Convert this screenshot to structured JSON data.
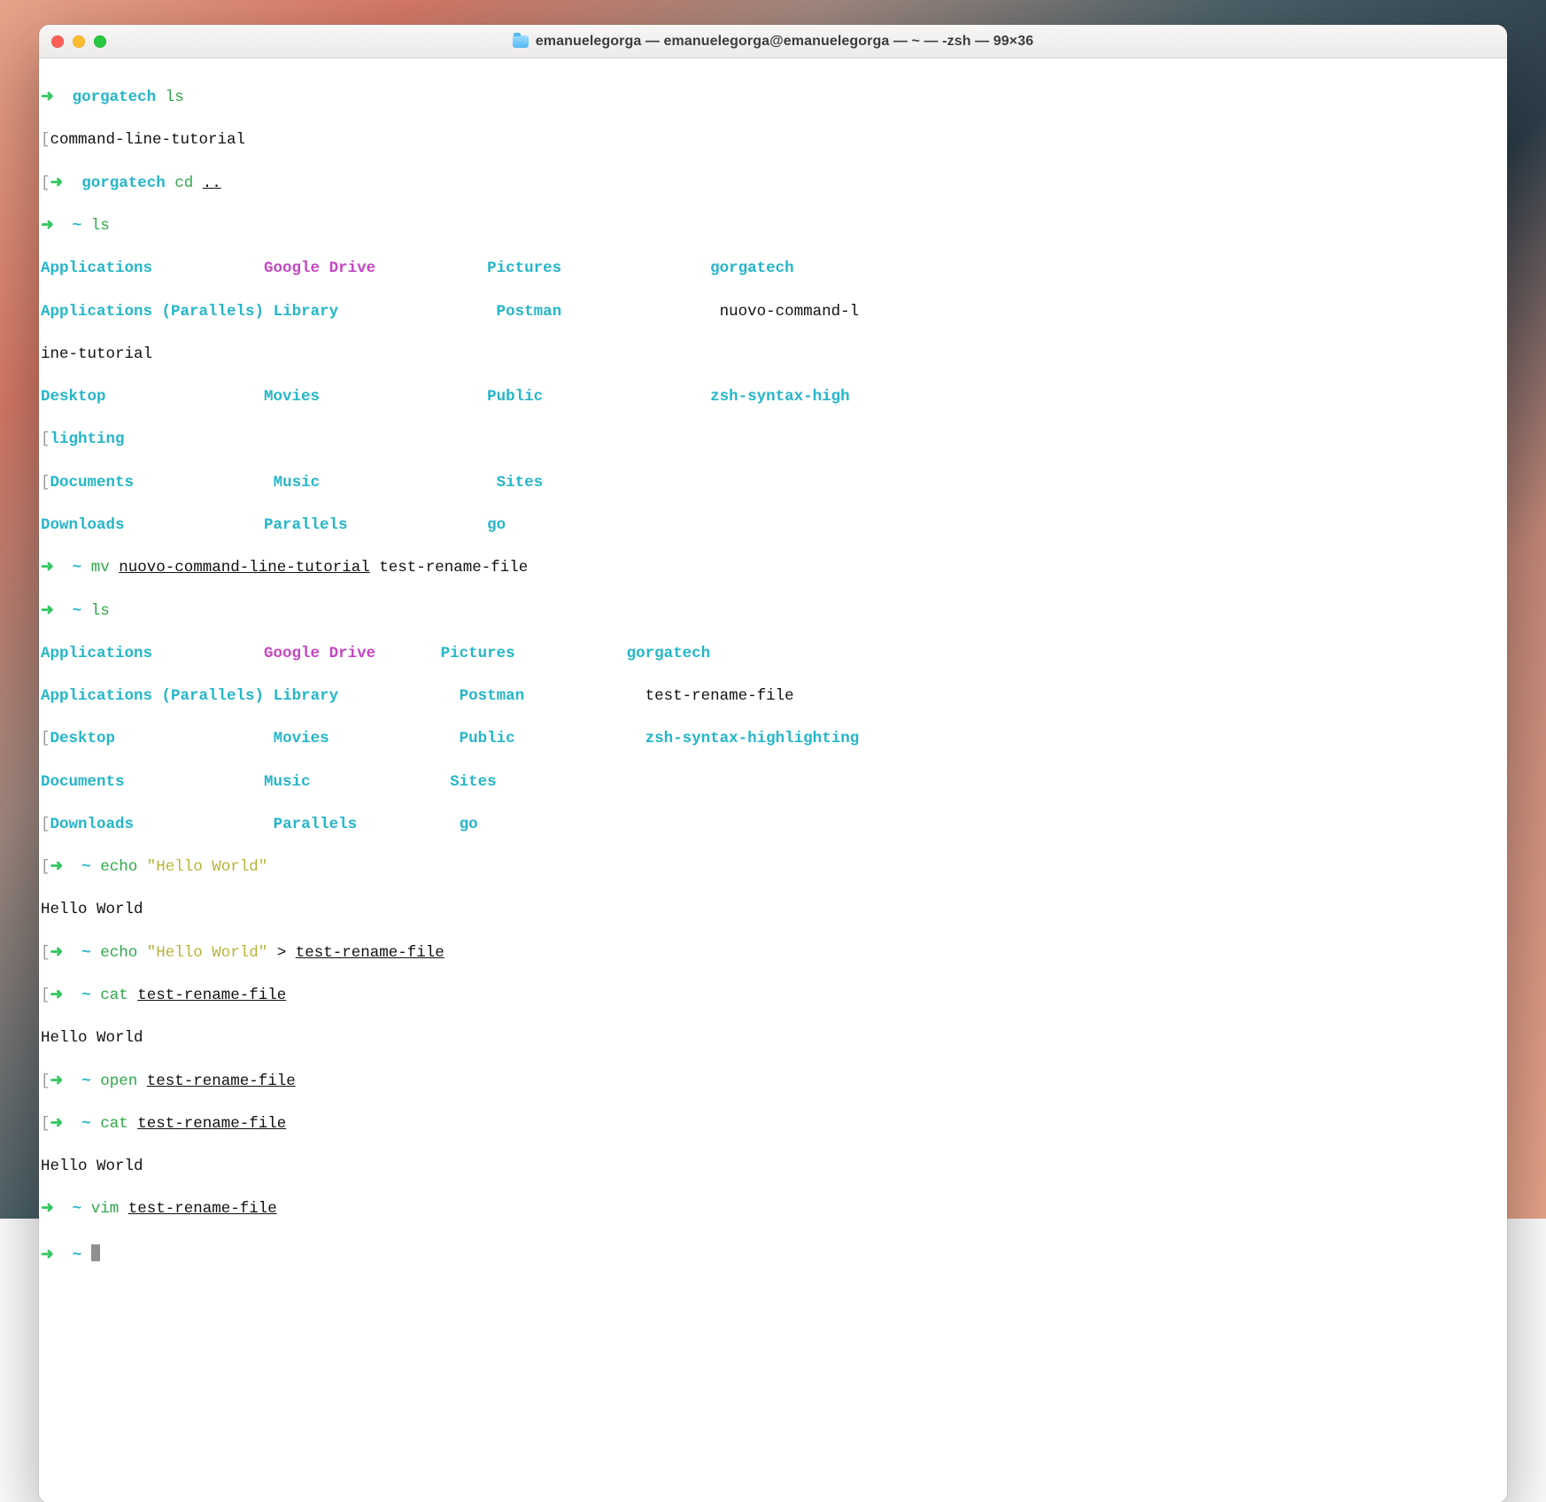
{
  "window": {
    "title": "emanuelegorga — emanuelegorga@emanuelegorga — ~ — -zsh — 99×36"
  },
  "c": {
    "arrow": "➜  ",
    "tilde": "~",
    "obrk": "[",
    "cbrk": "]"
  },
  "l1": {
    "host": "gorgatech ",
    "cmd": "ls"
  },
  "l2": {
    "out": "command-line-tutorial"
  },
  "l3": {
    "host": "gorgatech ",
    "cmd": "cd ",
    "arg": ".."
  },
  "l4": {
    "prompt": "~ ",
    "cmd": "ls"
  },
  "ls1": {
    "c1r1": "Applications            ",
    "c2r1": "Google",
    "c2r1b": " Drive",
    "c2r1pad": "            ",
    "c3r1": "Pictures",
    "c3r1pad": "                ",
    "c4r1": "gorgatech",
    "c1r2": "Applications (Parallels)",
    "c1r2pad": " ",
    "c2r2": "Library",
    "c2r2pad": "                 ",
    "c3r2": "Postman",
    "c3r2pad": "                 ",
    "c4r2": "nuovo-command-l",
    "wrap1": "ine-tutorial",
    "c1r3": "Desktop",
    "c1r3pad": "                 ",
    "c2r3": "Movies",
    "c2r3pad": "                  ",
    "c3r3": "Public",
    "c3r3pad": "                  ",
    "c4r3": "zsh-syntax-high",
    "wrap2": "lighting",
    "c1r4": "Documents",
    "c1r4pad": "               ",
    "c2r4": "Music",
    "c2r4pad": "                   ",
    "c3r4": "Sites",
    "c1r5": "Downloads",
    "c1r5pad": "               ",
    "c2r5": "Parallels",
    "c2r5pad": "               ",
    "c3r5": "go"
  },
  "l5": {
    "prompt": "~ ",
    "cmd": "mv ",
    "arg1": "nuovo-command-line-tutorial",
    "sp": " ",
    "arg2": "test-rename-file"
  },
  "l6": {
    "prompt": "~ ",
    "cmd": "ls"
  },
  "ls2": {
    "c1r1": "Applications            ",
    "c2r1": "Google",
    "c2r1b": " Drive",
    "c2r1pad": "       ",
    "c3r1": "Pictures",
    "c3r1pad": "            ",
    "c4r1": "gorgatech",
    "c1r2": "Applications (Parallels)",
    "c1r2pad": " ",
    "c2r2": "Library",
    "c2r2pad": "             ",
    "c3r2": "Postman",
    "c3r2pad": "             ",
    "c4r2": "test-rename-file",
    "c1r3": "Desktop",
    "c1r3pad": "                 ",
    "c2r3": "Movies",
    "c2r3pad": "              ",
    "c3r3": "Public",
    "c3r3pad": "              ",
    "c4r3": "zsh-syntax-highlighting",
    "c1r4": "Documents",
    "c1r4pad": "               ",
    "c2r4": "Music",
    "c2r4pad": "               ",
    "c3r4": "Sites",
    "c1r5": "Downloads",
    "c1r5pad": "               ",
    "c2r5": "Parallels",
    "c2r5pad": "           ",
    "c3r5": "go"
  },
  "l7": {
    "prompt": "~ ",
    "cmd": "echo ",
    "arg": "\"Hello World\""
  },
  "l8": {
    "out": "Hello World"
  },
  "l9": {
    "prompt": "~ ",
    "cmd": "echo ",
    "arg": "\"Hello World\"",
    "redir": " > ",
    "file": "test-rename-file"
  },
  "l10": {
    "prompt": "~ ",
    "cmd": "cat ",
    "file": "test-rename-file"
  },
  "l11": {
    "out": "Hello World"
  },
  "l12": {
    "prompt": "~ ",
    "cmd": "open ",
    "file": "test-rename-file"
  },
  "l13": {
    "prompt": "~ ",
    "cmd": "cat ",
    "file": "test-rename-file"
  },
  "l14": {
    "out": "Hello World"
  },
  "l15": {
    "prompt": "~ ",
    "cmd": "vim ",
    "file": "test-rename-file"
  },
  "l16": {
    "prompt": "~ "
  }
}
